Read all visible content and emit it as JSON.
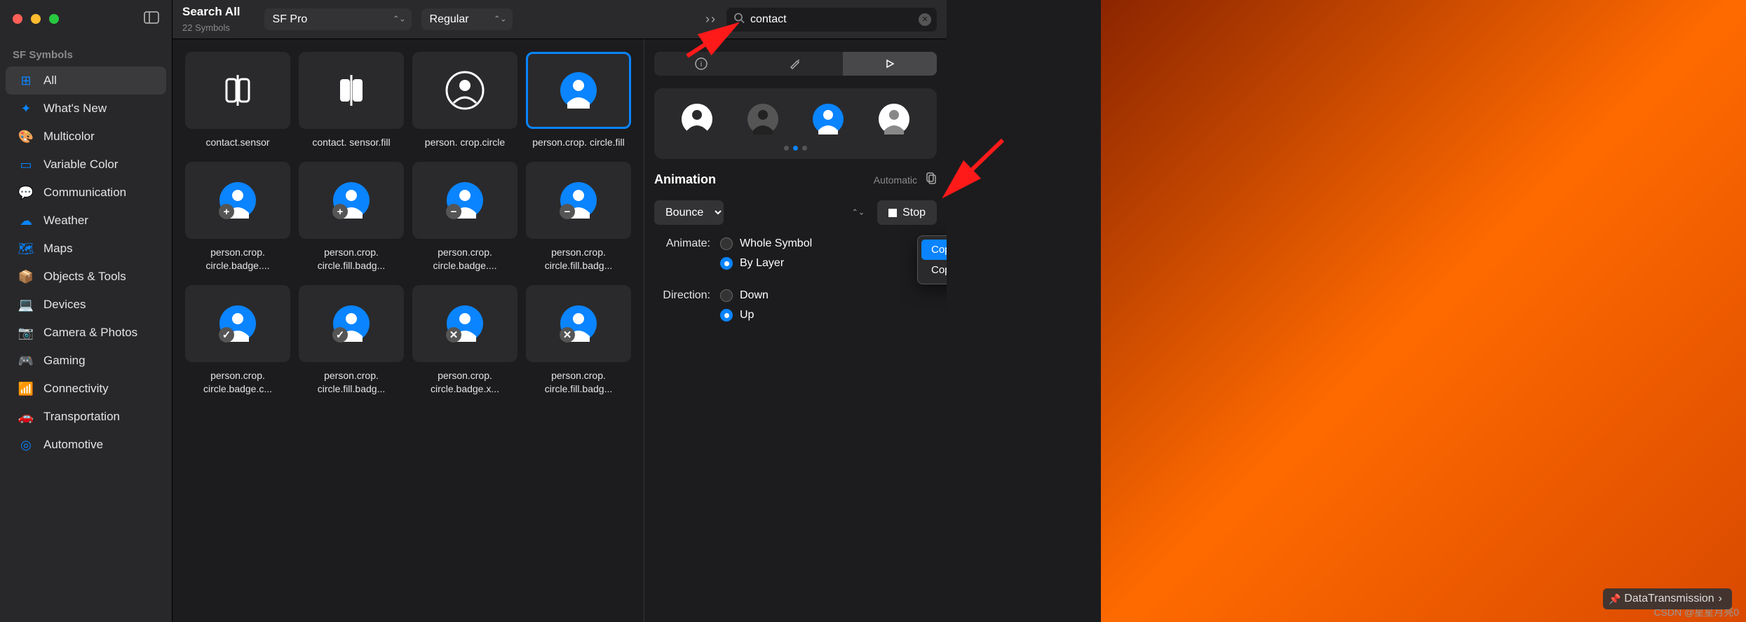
{
  "sidebar": {
    "section": "SF Symbols",
    "items": [
      {
        "icon": "grid",
        "label": "All",
        "active": true
      },
      {
        "icon": "sparkle",
        "label": "What's New"
      },
      {
        "icon": "palette",
        "label": "Multicolor"
      },
      {
        "icon": "vcolor",
        "label": "Variable Color"
      },
      {
        "icon": "bubble",
        "label": "Communication"
      },
      {
        "icon": "cloud",
        "label": "Weather"
      },
      {
        "icon": "map",
        "label": "Maps"
      },
      {
        "icon": "box",
        "label": "Objects & Tools"
      },
      {
        "icon": "laptop",
        "label": "Devices"
      },
      {
        "icon": "camera",
        "label": "Camera & Photos"
      },
      {
        "icon": "game",
        "label": "Gaming"
      },
      {
        "icon": "wifi",
        "label": "Connectivity"
      },
      {
        "icon": "car",
        "label": "Transportation"
      },
      {
        "icon": "steer",
        "label": "Automotive"
      }
    ]
  },
  "toolbar": {
    "title": "Search All",
    "subtitle": "22 Symbols",
    "font": "SF Pro",
    "weight": "Regular",
    "search_placeholder": "",
    "search_value": "contact"
  },
  "grid": [
    {
      "name": "contact.sensor",
      "icon": "sensor"
    },
    {
      "name": "contact. sensor.fill",
      "icon": "sensor-fill"
    },
    {
      "name": "person. crop.circle",
      "icon": "pcc"
    },
    {
      "name": "person.crop. circle.fill",
      "icon": "pccf",
      "selected": true
    },
    {
      "name": "person.crop. circle.badge....",
      "icon": "badge-plus"
    },
    {
      "name": "person.crop. circle.fill.badg...",
      "icon": "badge-plus-f"
    },
    {
      "name": "person.crop. circle.badge....",
      "icon": "badge-minus"
    },
    {
      "name": "person.crop. circle.fill.badg...",
      "icon": "badge-minus-f"
    },
    {
      "name": "person.crop. circle.badge.c...",
      "icon": "badge-check"
    },
    {
      "name": "person.crop. circle.fill.badg...",
      "icon": "badge-check-f"
    },
    {
      "name": "person.crop. circle.badge.x...",
      "icon": "badge-x"
    },
    {
      "name": "person.crop. circle.fill.badg...",
      "icon": "badge-x-f"
    }
  ],
  "inspector": {
    "animation_title": "Animation",
    "automatic": "Automatic",
    "effect": "Bounce",
    "stop": "Stop",
    "animate_label": "Animate:",
    "animate_opts": [
      "Whole Symbol",
      "By Layer"
    ],
    "animate_sel": 1,
    "direction_label": "Direction:",
    "direction_opts": [
      "Down",
      "Up"
    ],
    "direction_sel": 1
  },
  "context_menu": [
    "Copy Configuration for Swift",
    "Copy Configuration for Objective-C"
  ],
  "badge": "DataTransmission",
  "watermark": "CSDN @星星月亮0"
}
